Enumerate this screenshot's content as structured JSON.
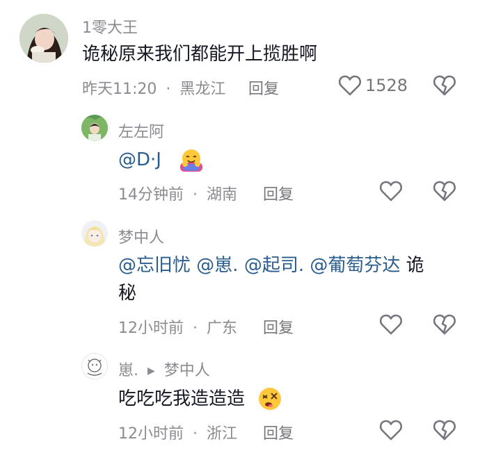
{
  "comments": [
    {
      "username": "1零大王",
      "text": "诡秘原来我们都能开上揽胜啊",
      "time": "昨天11:20",
      "location": "黑龙江",
      "reply_label": "回复",
      "likes": "1528",
      "sep": "·"
    },
    {
      "username": "左左阿",
      "mention": "@D·J",
      "time": "14分钟前",
      "location": "湖南",
      "reply_label": "回复",
      "sep": "·"
    },
    {
      "username": "梦中人",
      "mentions": [
        "@忘旧忧",
        "@崽.",
        "@起司.",
        "@葡萄芬达"
      ],
      "text_after": "诡",
      "text_line2": "秘",
      "time": "12小时前",
      "location": "广东",
      "reply_label": "回复",
      "sep": "·"
    },
    {
      "username": "崽.",
      "reply_to": "梦中人",
      "text": "吃吃吃我造造造",
      "time": "12小时前",
      "location": "浙江",
      "reply_label": "回复",
      "sep": "·"
    }
  ],
  "icons": {
    "like": "heart-outline-icon",
    "dislike": "broken-heart-icon",
    "reply_arrow": "triangle-right-icon"
  },
  "colors": {
    "mention": "#2a5c8d",
    "meta": "#8a8b91",
    "text": "#161823"
  }
}
